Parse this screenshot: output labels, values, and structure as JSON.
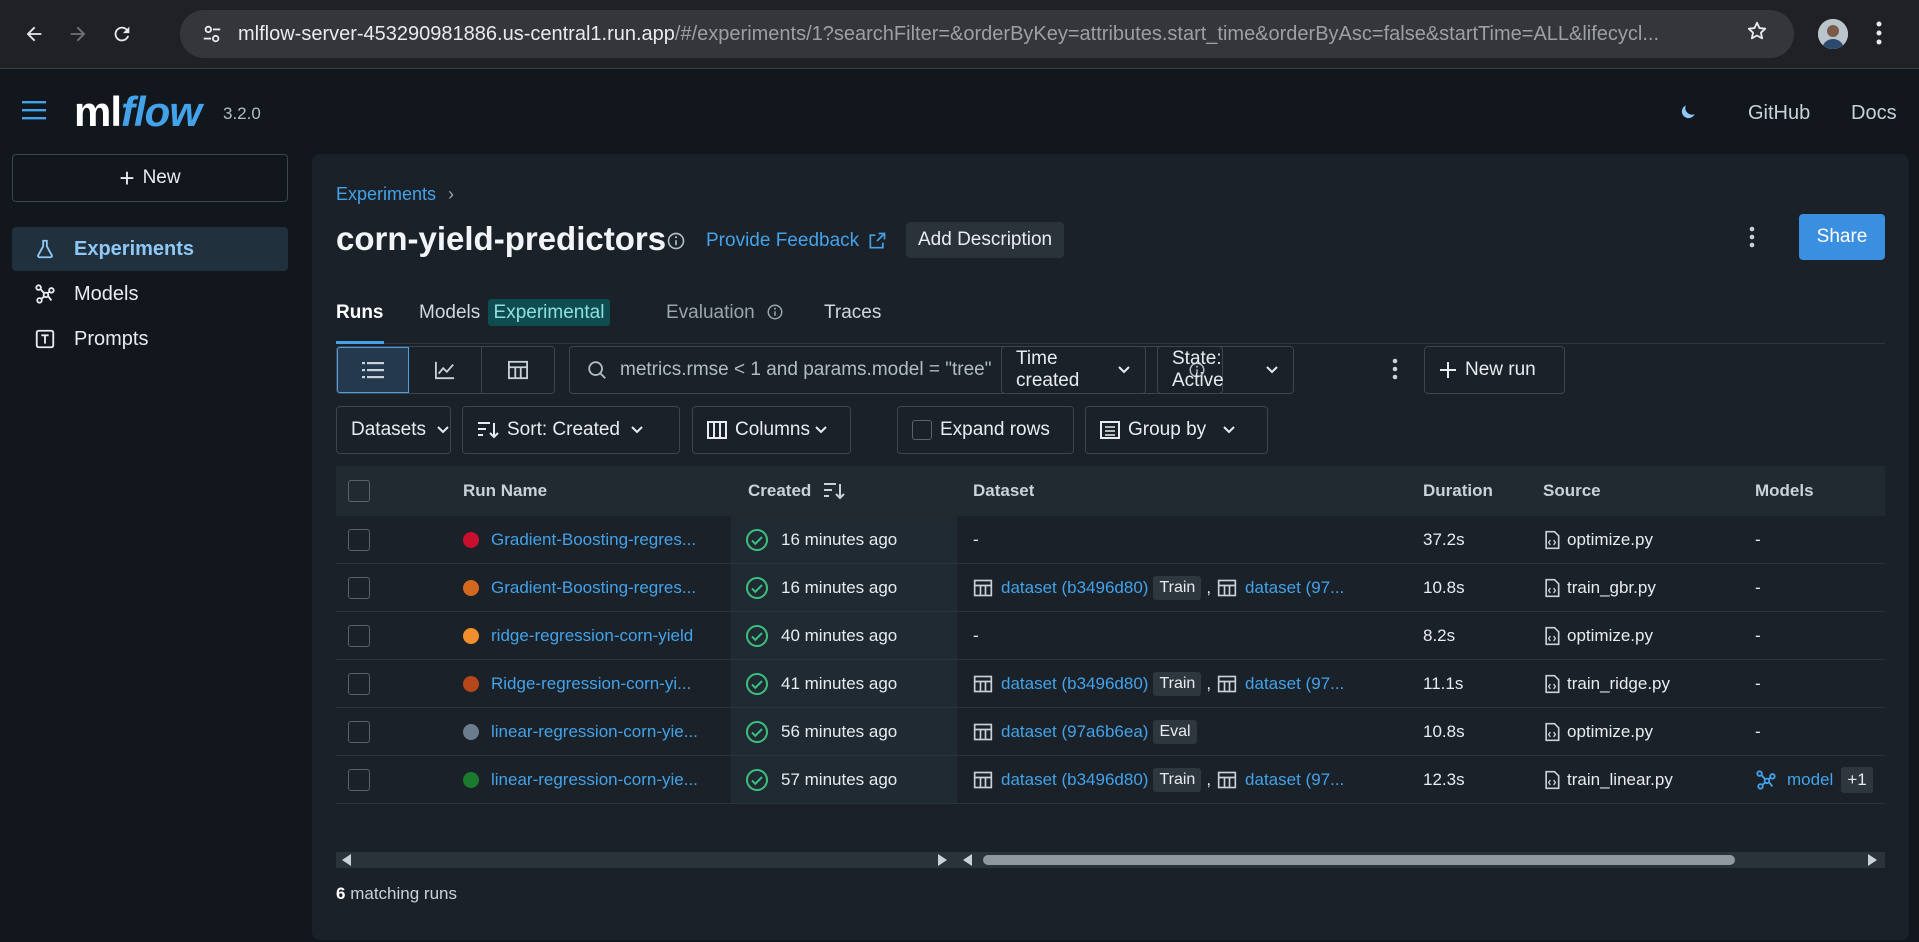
{
  "browser": {
    "url_host": "mlflow-server-453290981886.us-central1.run.app",
    "url_path": "/#/experiments/1?searchFilter=&orderByKey=attributes.start_time&orderByAsc=false&startTime=ALL&lifecycl..."
  },
  "header": {
    "logo_ml": "ml",
    "logo_flow": "flow",
    "version": "3.2.0",
    "github": "GitHub",
    "docs": "Docs"
  },
  "sidebar": {
    "new_label": "New",
    "items": [
      {
        "label": "Experiments",
        "icon": "flask-icon"
      },
      {
        "label": "Models",
        "icon": "models-icon"
      },
      {
        "label": "Prompts",
        "icon": "prompts-icon"
      }
    ]
  },
  "main": {
    "breadcrumb": "Experiments",
    "title": "corn-yield-predictors",
    "feedback": "Provide Feedback",
    "add_description": "Add Description",
    "share": "Share",
    "tabs": {
      "runs": "Runs",
      "models": "Models",
      "models_badge": "Experimental",
      "evaluation": "Evaluation",
      "traces": "Traces"
    },
    "search_placeholder": "metrics.rmse < 1 and params.model = \"tree\"",
    "time_created": "Time created",
    "state": "State: Active",
    "new_run": "New run",
    "datasets": "Datasets",
    "sort": "Sort: Created",
    "columns": "Columns",
    "expand_rows": "Expand rows",
    "group_by": "Group by",
    "matching_count": "6",
    "matching_label": "matching runs"
  },
  "table": {
    "headers": {
      "run_name": "Run Name",
      "created": "Created",
      "dataset": "Dataset",
      "duration": "Duration",
      "source": "Source",
      "models": "Models"
    },
    "rows": [
      {
        "color": "#c8102e",
        "name": "Gradient-Boosting-regres...",
        "created": "16 minutes ago",
        "ds1": "-",
        "ds1_tag": "",
        "ds2": "",
        "duration": "37.2s",
        "source": "optimize.py",
        "model": "-",
        "model_extra": ""
      },
      {
        "color": "#d2691e",
        "name": "Gradient-Boosting-regres...",
        "created": "16 minutes ago",
        "ds1": "dataset (b3496d80)",
        "ds1_tag": "Train",
        "ds2": "dataset (97...",
        "duration": "10.8s",
        "source": "train_gbr.py",
        "model": "-",
        "model_extra": ""
      },
      {
        "color": "#f28e2b",
        "name": "ridge-regression-corn-yield",
        "created": "40 minutes ago",
        "ds1": "-",
        "ds1_tag": "",
        "ds2": "",
        "duration": "8.2s",
        "source": "optimize.py",
        "model": "-",
        "model_extra": ""
      },
      {
        "color": "#b5471b",
        "name": "Ridge-regression-corn-yi...",
        "created": "41 minutes ago",
        "ds1": "dataset (b3496d80)",
        "ds1_tag": "Train",
        "ds2": "dataset (97...",
        "duration": "11.1s",
        "source": "train_ridge.py",
        "model": "-",
        "model_extra": ""
      },
      {
        "color": "#6b7d8c",
        "name": "linear-regression-corn-yie...",
        "created": "56 minutes ago",
        "ds1": "dataset (97a6b6ea)",
        "ds1_tag": "Eval",
        "ds2": "",
        "duration": "10.8s",
        "source": "optimize.py",
        "model": "-",
        "model_extra": ""
      },
      {
        "color": "#1a7a2e",
        "name": "linear-regression-corn-yie...",
        "created": "57 minutes ago",
        "ds1": "dataset (b3496d80)",
        "ds1_tag": "Train",
        "ds2": "dataset (97...",
        "duration": "12.3s",
        "source": "train_linear.py",
        "model": "model",
        "model_extra": "+1"
      }
    ]
  }
}
